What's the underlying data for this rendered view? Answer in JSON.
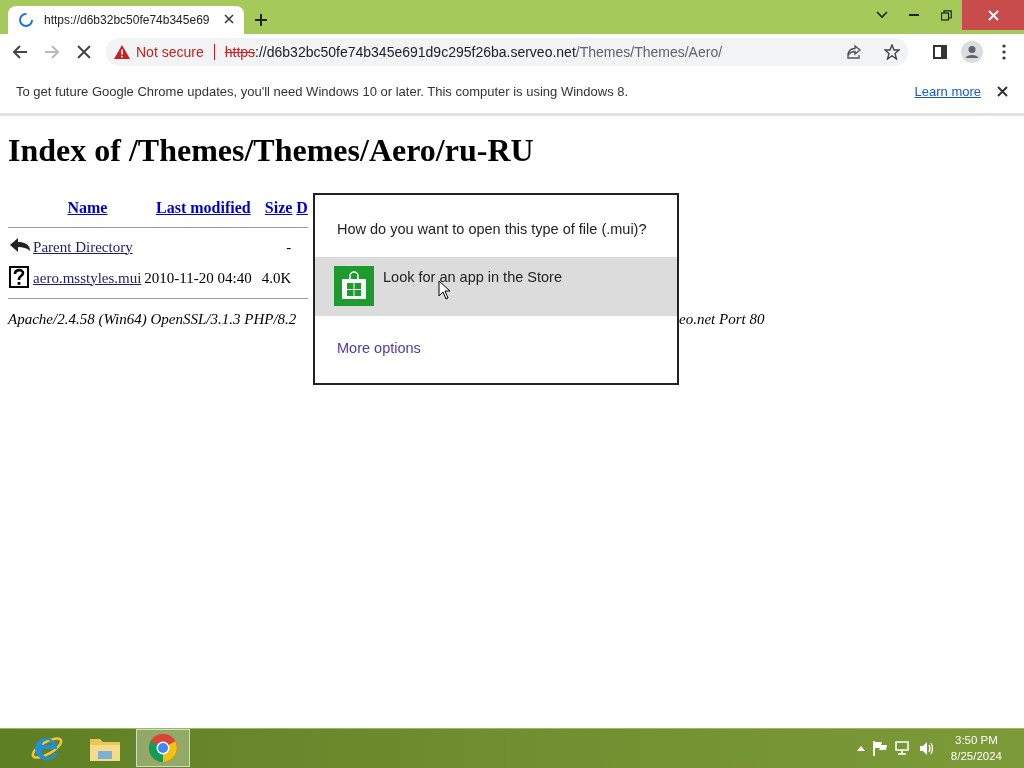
{
  "browser": {
    "tabs": [
      {
        "title": "https://d6b32bc50fe74b345e69",
        "loading": true,
        "selected": true
      }
    ],
    "address": {
      "security": "Not secure",
      "scheme": "https",
      "host": "://d6b32bc50fe74b345e691d9c295f26ba.serveo.net",
      "path": "/Themes/Themes/Aero/"
    },
    "infobar": {
      "message": "To get future Google Chrome updates, you'll need Windows 10 or later. This computer is using Windows 8.",
      "link": "Learn more"
    }
  },
  "page": {
    "heading": "Index of /Themes/Themes/Aero/ru-RU",
    "columns": [
      "Name",
      "Last modified",
      "Size",
      "D"
    ],
    "rows": [
      {
        "kind": "parent",
        "name": "Parent Directory",
        "size": "-"
      },
      {
        "kind": "file",
        "name": "aero.msstyles.mui",
        "modified": "2010-11-20 04:40",
        "size": "4.0K"
      }
    ],
    "footer_left": "Apache/2.4.58 (Win64) OpenSSL/3.1.3 PHP/8.2",
    "footer_right": "eo.net Port 80"
  },
  "dialog": {
    "question": "How do you want to open this type of file (.mui)?",
    "options": [
      {
        "label": "Look for an app in the Store",
        "selected": true
      }
    ],
    "link": "More options"
  },
  "taskbar": {
    "apps": [
      {
        "kind": "ie",
        "selected": false
      },
      {
        "kind": "explorer",
        "selected": false
      },
      {
        "kind": "chrome",
        "selected": true
      }
    ],
    "time": "3:50 PM",
    "date": "8/25/2024"
  }
}
